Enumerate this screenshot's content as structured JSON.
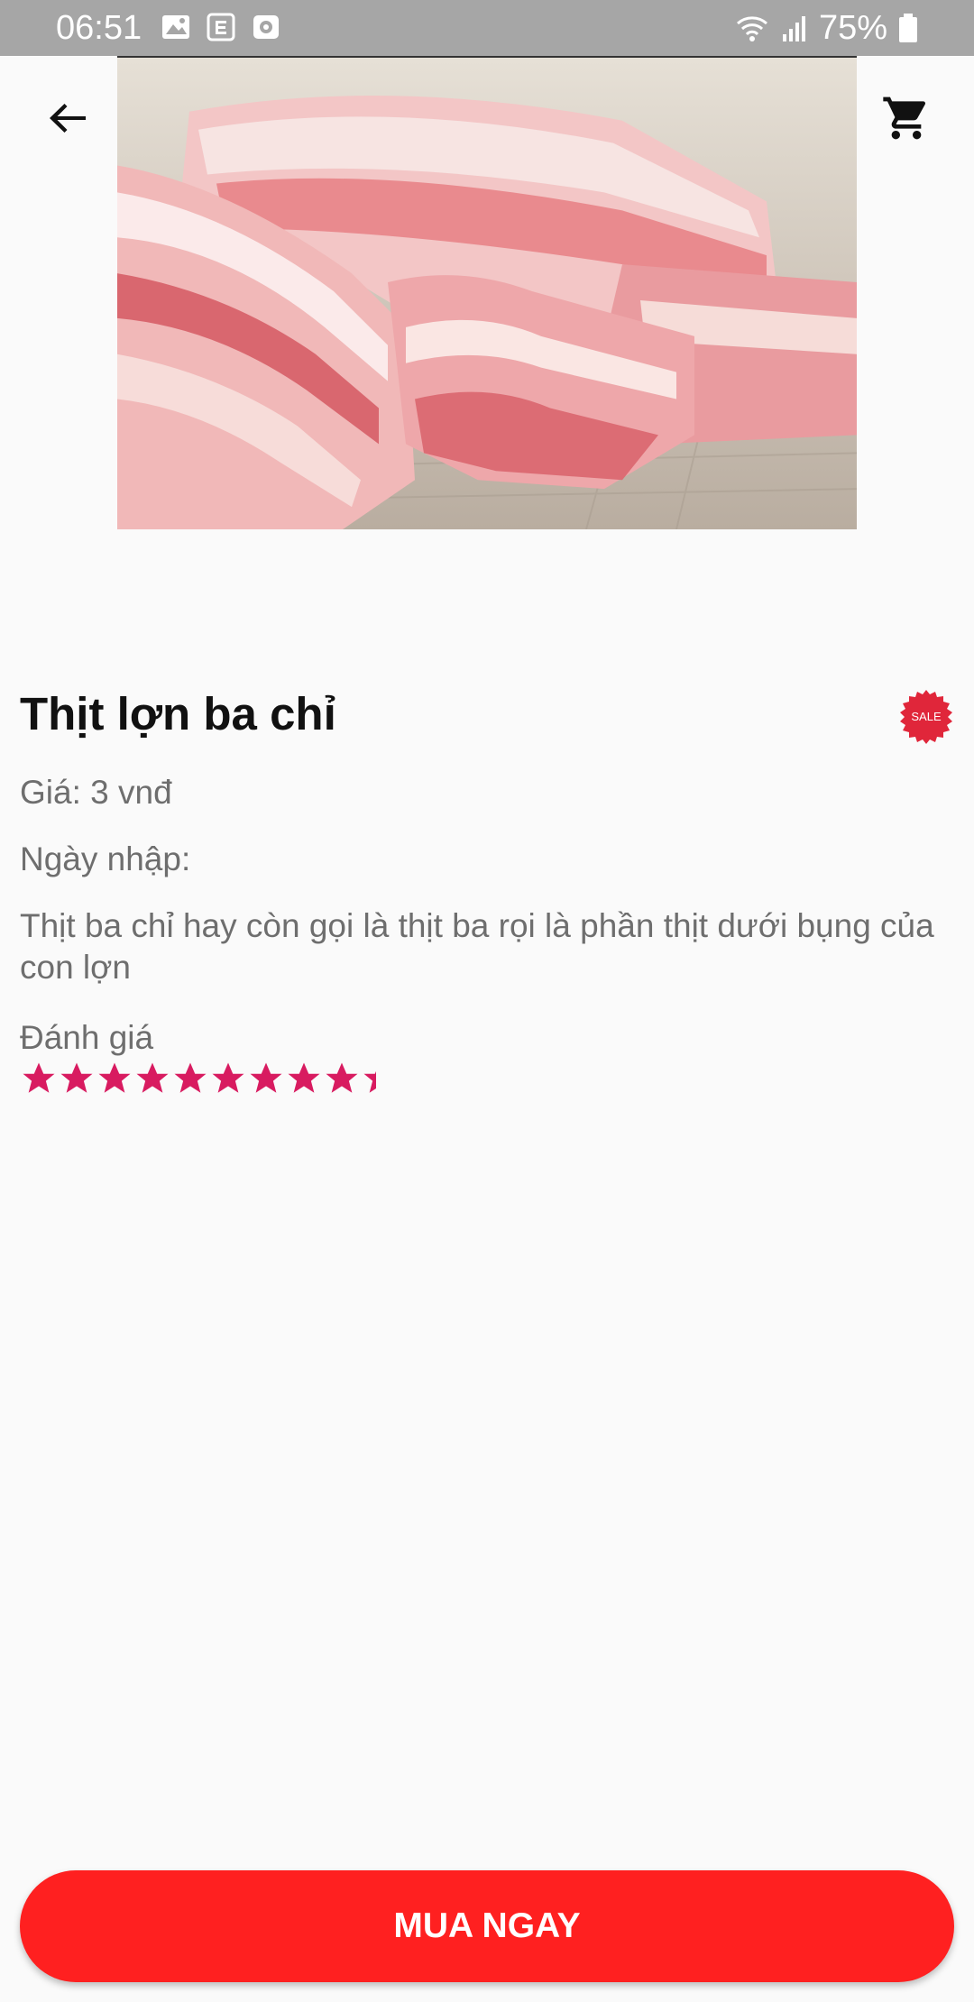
{
  "status_bar": {
    "time": "06:51",
    "battery": "75%",
    "icons_left": [
      "image-icon",
      "news-icon",
      "clock-app-icon"
    ],
    "icons_right": [
      "wifi-icon",
      "signal-icon",
      "battery-icon"
    ]
  },
  "header": {
    "back_icon": "arrow-left-icon",
    "cart_icon": "shopping-cart-icon"
  },
  "product": {
    "image_subject": "raw pork belly slices",
    "title": "Thịt lợn ba chỉ",
    "badge": "SALE",
    "price": "Giá: 3 vnđ",
    "import_date": "Ngày nhập:",
    "description": "Thịt ba chỉ hay còn gọi là thịt ba rọi là phần thịt dưới bụng của con lợn",
    "rating_label": "Đánh giá",
    "rating_stars_visible": 9.3
  },
  "actions": {
    "buy_label": "MUA NGAY"
  },
  "colors": {
    "status_bar": "#a6a6a6",
    "accent_red": "#ff2020",
    "badge_red": "#e0263a",
    "star_pink": "#d81b60",
    "background": "#fafafa"
  }
}
